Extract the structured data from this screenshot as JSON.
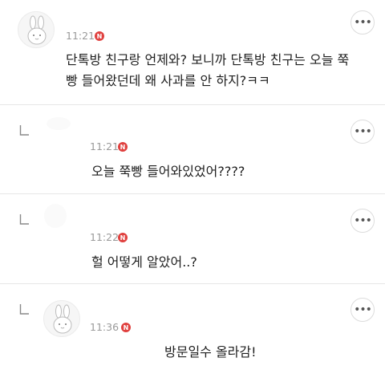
{
  "comments": [
    {
      "time": "11:21",
      "badge": "N",
      "text_line1": "단톡방 친구랑 언제와? 보니까 단톡방 친구는 오늘 쭉",
      "text_line2": "빵 들어왔던데 왜 사과를 안 하지?ㅋㅋ",
      "avatar_icon": "bunny-avatar-icon",
      "more_label": "•••"
    },
    {
      "time": "11:21",
      "badge": "N",
      "text": "오늘 쭉빵 들어와있었어????",
      "more_label": "•••"
    },
    {
      "time": "11:22",
      "badge": "N",
      "text": "헐 어떻게 알았어..?",
      "more_label": "•••"
    },
    {
      "time": "11:36",
      "badge": "N",
      "text": "방문일수 올라감!",
      "avatar_icon": "bunny-avatar-icon",
      "more_label": "•••"
    }
  ],
  "colors": {
    "badge": "#e0413f",
    "time": "#9a9a9a",
    "divider": "#e6e6e6"
  }
}
